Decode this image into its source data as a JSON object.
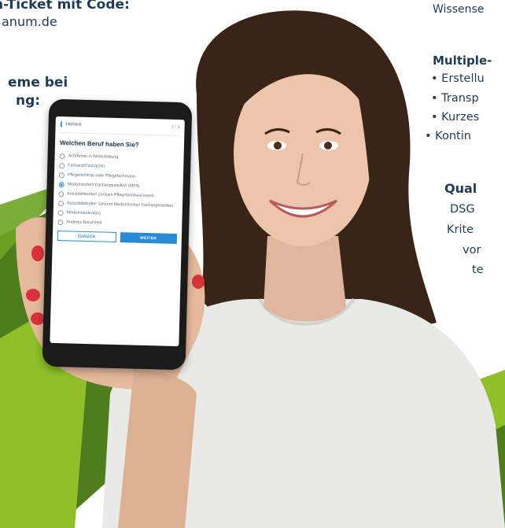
{
  "colors": {
    "green_dark": "#4f7d1e",
    "green_light": "#8fbf2a",
    "text_navy": "#1f3b57",
    "accent_blue": "#2a8ad4"
  },
  "left_text": {
    "line1": "n-Ticket mit Code:",
    "line2": "anum.de",
    "line3": "eme bei",
    "line4": "ng:"
  },
  "right_text": {
    "line1": "Wissense",
    "line2": "Multiple-",
    "bullets": [
      "• Erstellu",
      "• Transp",
      "• Kurzes",
      "• Kontin"
    ],
    "qual_title": "Qual",
    "qual_lines": [
      "DSG",
      "Krite",
      "vor",
      "te"
    ]
  },
  "app": {
    "logo": "Humeo",
    "step": "2 / 3",
    "question": "Welchen Beruf haben Sie?",
    "options": [
      {
        "label": "Arzt/Ärztin in Weiterbildung",
        "selected": false
      },
      {
        "label": "Facharzt/Fachärztin",
        "selected": false
      },
      {
        "label": "Pflegefachfrau oder Pflegefachmann",
        "selected": false
      },
      {
        "label": "Medizinische/r Fachangestellte/r (MFA)",
        "selected": true
      },
      {
        "label": "Auszubildende/r zur/zum Pflegefachfrau/-mann",
        "selected": false
      },
      {
        "label": "Auszubildende/r zur/zum Medizinischen Fachangestellten",
        "selected": false
      },
      {
        "label": "Medizinstudent(in)",
        "selected": false
      },
      {
        "label": "Anderes Berufsfeld",
        "selected": false
      }
    ],
    "back_label": "ZURÜCK",
    "next_label": "WEITER"
  }
}
